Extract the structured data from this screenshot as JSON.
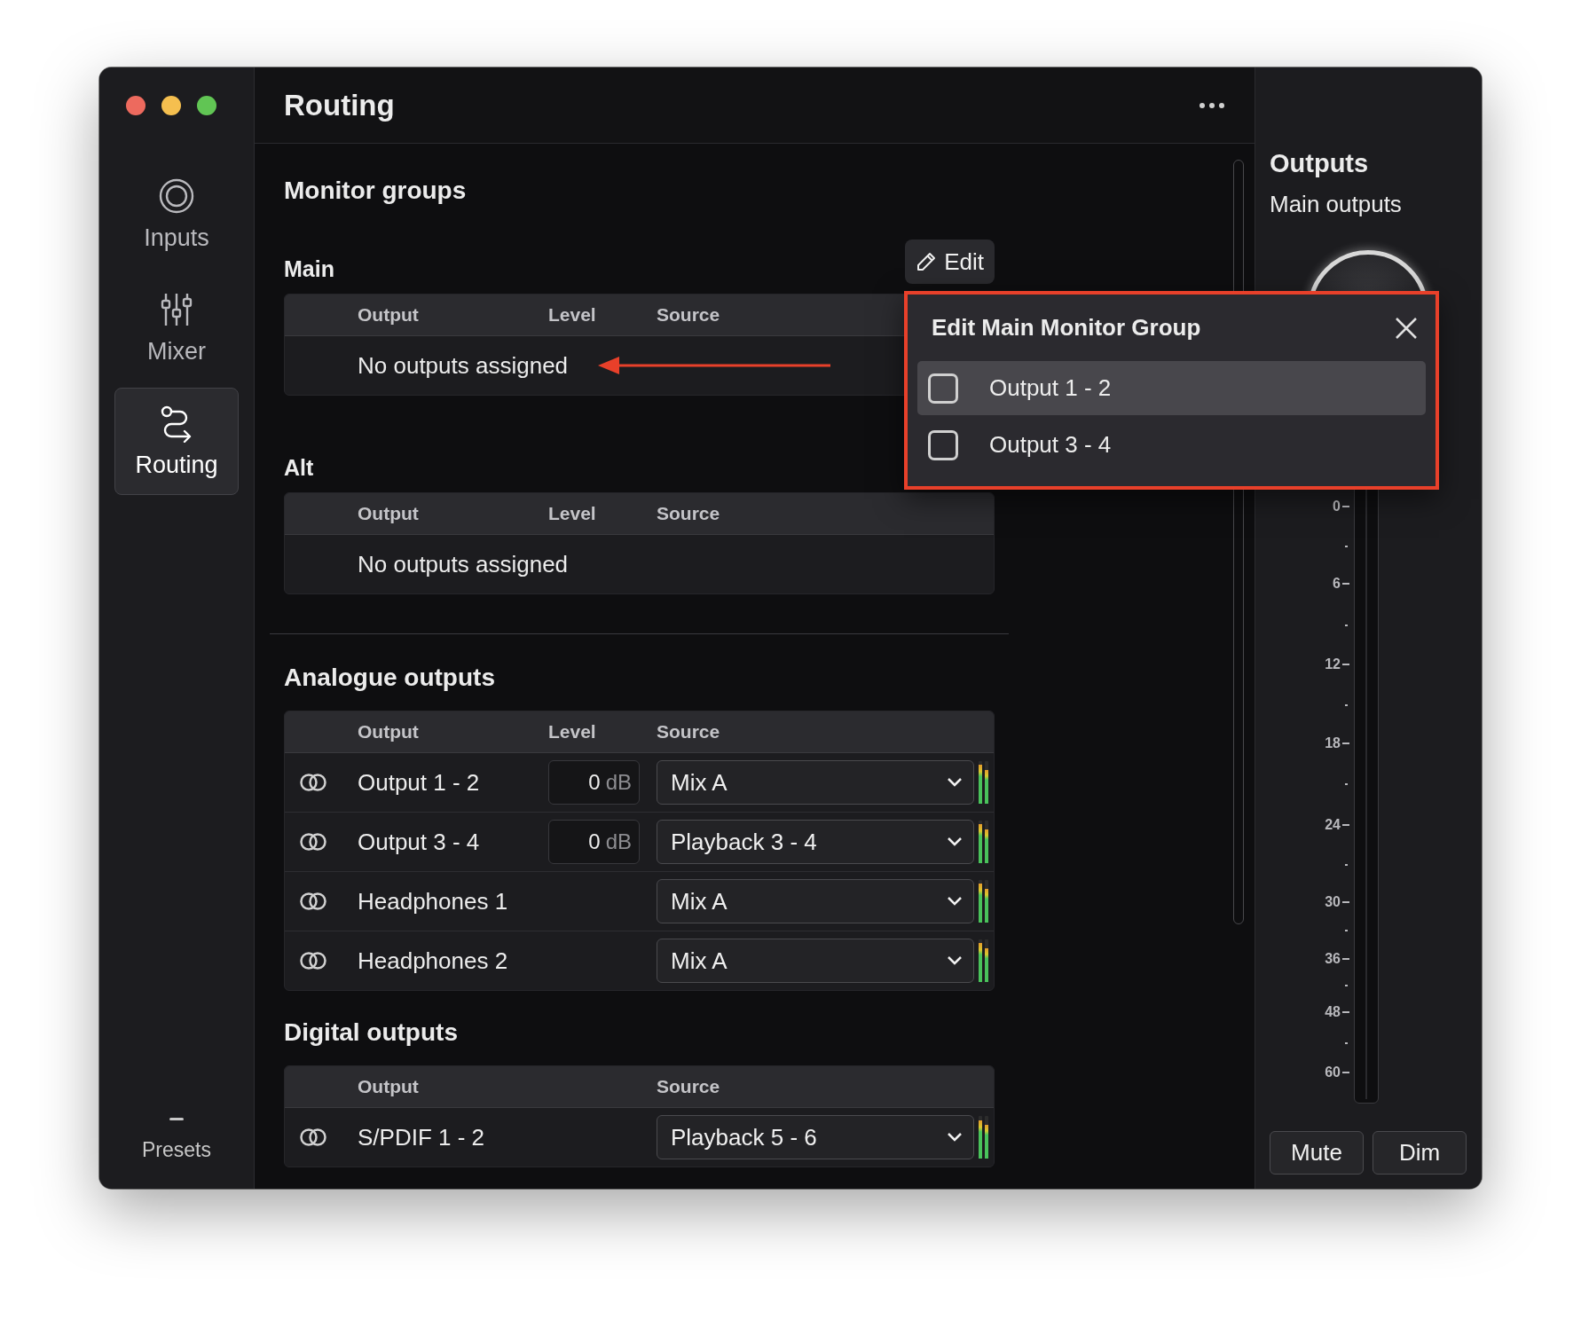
{
  "window": {
    "controls": [
      {
        "color": "#ed6a5e"
      },
      {
        "color": "#f5bf4f"
      },
      {
        "color": "#61c554"
      }
    ]
  },
  "sidebar": {
    "items": [
      {
        "label": "Inputs",
        "kind": "inputs",
        "selected": false
      },
      {
        "label": "Mixer",
        "kind": "mixer",
        "selected": false
      },
      {
        "label": "Routing",
        "kind": "routing",
        "selected": true
      }
    ],
    "footer": {
      "label": "Presets"
    }
  },
  "header": {
    "title": "Routing"
  },
  "monitor_groups": {
    "title": "Monitor groups",
    "groups": [
      {
        "name": "Main",
        "edit_button": "Edit",
        "columns": [
          {
            "label": "Output",
            "kind": "output"
          },
          {
            "label": "Level",
            "kind": "level"
          },
          {
            "label": "Source",
            "kind": "source"
          }
        ],
        "empty_message": "No outputs assigned",
        "annotation_arrow": true
      },
      {
        "name": "Alt",
        "columns": [
          {
            "label": "Output",
            "kind": "output"
          },
          {
            "label": "Level",
            "kind": "level"
          },
          {
            "label": "Source",
            "kind": "source"
          }
        ],
        "empty_message": "No outputs assigned",
        "annotation_arrow": false
      }
    ]
  },
  "sections": [
    {
      "title": "Analogue outputs",
      "columns": [
        {
          "label": "Output",
          "kind": "output"
        },
        {
          "label": "Level",
          "kind": "level"
        },
        {
          "label": "Source",
          "kind": "source"
        }
      ],
      "rows": [
        {
          "name": "Output 1 - 2",
          "level_value": "0",
          "level_unit": "dB",
          "source": "Mix A",
          "meters": [
            {
              "level": 0.92
            },
            {
              "level": 0.8
            }
          ]
        },
        {
          "name": "Output 3 - 4",
          "level_value": "0",
          "level_unit": "dB",
          "source": "Playback 3 - 4",
          "meters": [
            {
              "level": 0.92
            },
            {
              "level": 0.8
            }
          ]
        },
        {
          "name": "Headphones 1",
          "source": "Mix A",
          "meters": [
            {
              "level": 0.92
            },
            {
              "level": 0.8
            }
          ]
        },
        {
          "name": "Headphones 2",
          "source": "Mix A",
          "meters": [
            {
              "level": 0.92
            },
            {
              "level": 0.8
            }
          ]
        }
      ]
    },
    {
      "title": "Digital outputs",
      "columns": [
        {
          "label": "Output",
          "kind": "output"
        },
        {
          "label": "Source",
          "kind": "source"
        }
      ],
      "rows": [
        {
          "name": "S/PDIF 1 - 2",
          "source": "Playback 5 - 6",
          "meters": [
            {
              "level": 0.9
            },
            {
              "level": 0.8
            }
          ]
        }
      ]
    }
  ],
  "popup": {
    "title": "Edit Main Monitor Group",
    "options": [
      {
        "label": "Output 1 - 2",
        "checked": false,
        "selected": true
      },
      {
        "label": "Output 3 - 4",
        "checked": false,
        "selected": false
      }
    ]
  },
  "right_panel": {
    "title": "Outputs",
    "subtitle": "Main outputs",
    "scale": [
      "0",
      "6",
      "12",
      "18",
      "24",
      "30",
      "36",
      "48",
      "60"
    ],
    "buttons": [
      "Mute",
      "Dim"
    ]
  }
}
